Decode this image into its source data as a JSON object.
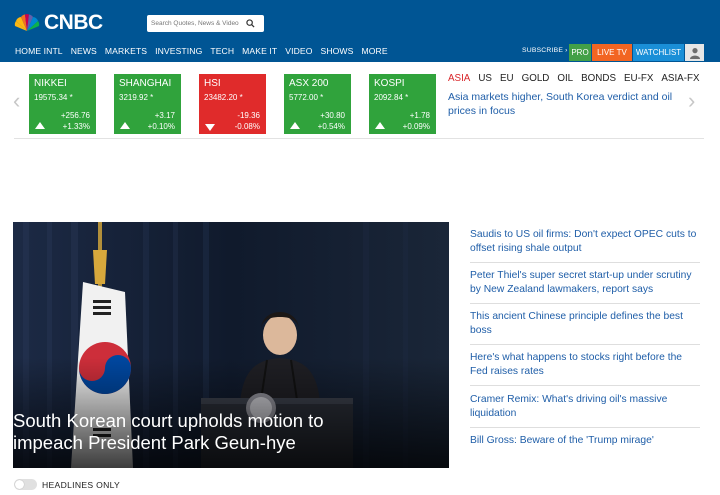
{
  "header": {
    "logo_text": "CNBC",
    "search_placeholder": "Search Quotes, News & Video",
    "nav": [
      "HOME INTL",
      "NEWS",
      "MARKETS",
      "INVESTING",
      "TECH",
      "MAKE IT",
      "VIDEO",
      "SHOWS",
      "MORE"
    ],
    "nav_has_dropdown_first": true,
    "subscribe": "SUBSCRIBE ›",
    "pro": "PRO",
    "live_tv": "LIVE TV",
    "watchlist": "WATCHLIST",
    "colors": {
      "bar": "#005594",
      "pro": "#43a047",
      "live_tv": "#f26522",
      "watchlist": "#1a8fd7"
    }
  },
  "markets": {
    "tickers": [
      {
        "name": "NIKKEI",
        "price": "19575.34 *",
        "change": "+256.76",
        "pct": "+1.33%",
        "direction": "up"
      },
      {
        "name": "SHANGHAI",
        "price": "3219.92 *",
        "change": "+3.17",
        "pct": "+0.10%",
        "direction": "up"
      },
      {
        "name": "HSI",
        "price": "23482.20 *",
        "change": "-19.36",
        "pct": "-0.08%",
        "direction": "down"
      },
      {
        "name": "ASX 200",
        "price": "5772.00 *",
        "change": "+30.80",
        "pct": "+0.54%",
        "direction": "up"
      },
      {
        "name": "KOSPI",
        "price": "2092.84 *",
        "change": "+1.78",
        "pct": "+0.09%",
        "direction": "up"
      }
    ],
    "region_tabs": [
      "ASIA",
      "US",
      "EU",
      "GOLD",
      "OIL",
      "BONDS",
      "EU-FX",
      "ASIA-FX"
    ],
    "active_region": "ASIA",
    "region_headline": "Asia markets higher, South Korea verdict and oil prices in focus",
    "colors": {
      "up": "#30a33c",
      "down": "#e02b2b"
    }
  },
  "hero": {
    "caption": "South Korean court upholds motion to impeach President Park Geun-hye"
  },
  "headlines": [
    "Saudis to US oil firms: Don't expect OPEC cuts to offset rising shale output",
    "Peter Thiel's super secret start-up under scrutiny by New Zealand lawmakers, report says",
    "This ancient Chinese principle defines the best boss",
    "Here's what happens to stocks right before the Fed raises rates",
    "Cramer Remix: What's driving oil's massive liquidation",
    "Bill Gross: Beware of the 'Trump mirage'"
  ],
  "toggle": {
    "label": "HEADLINES ONLY",
    "on": false
  }
}
